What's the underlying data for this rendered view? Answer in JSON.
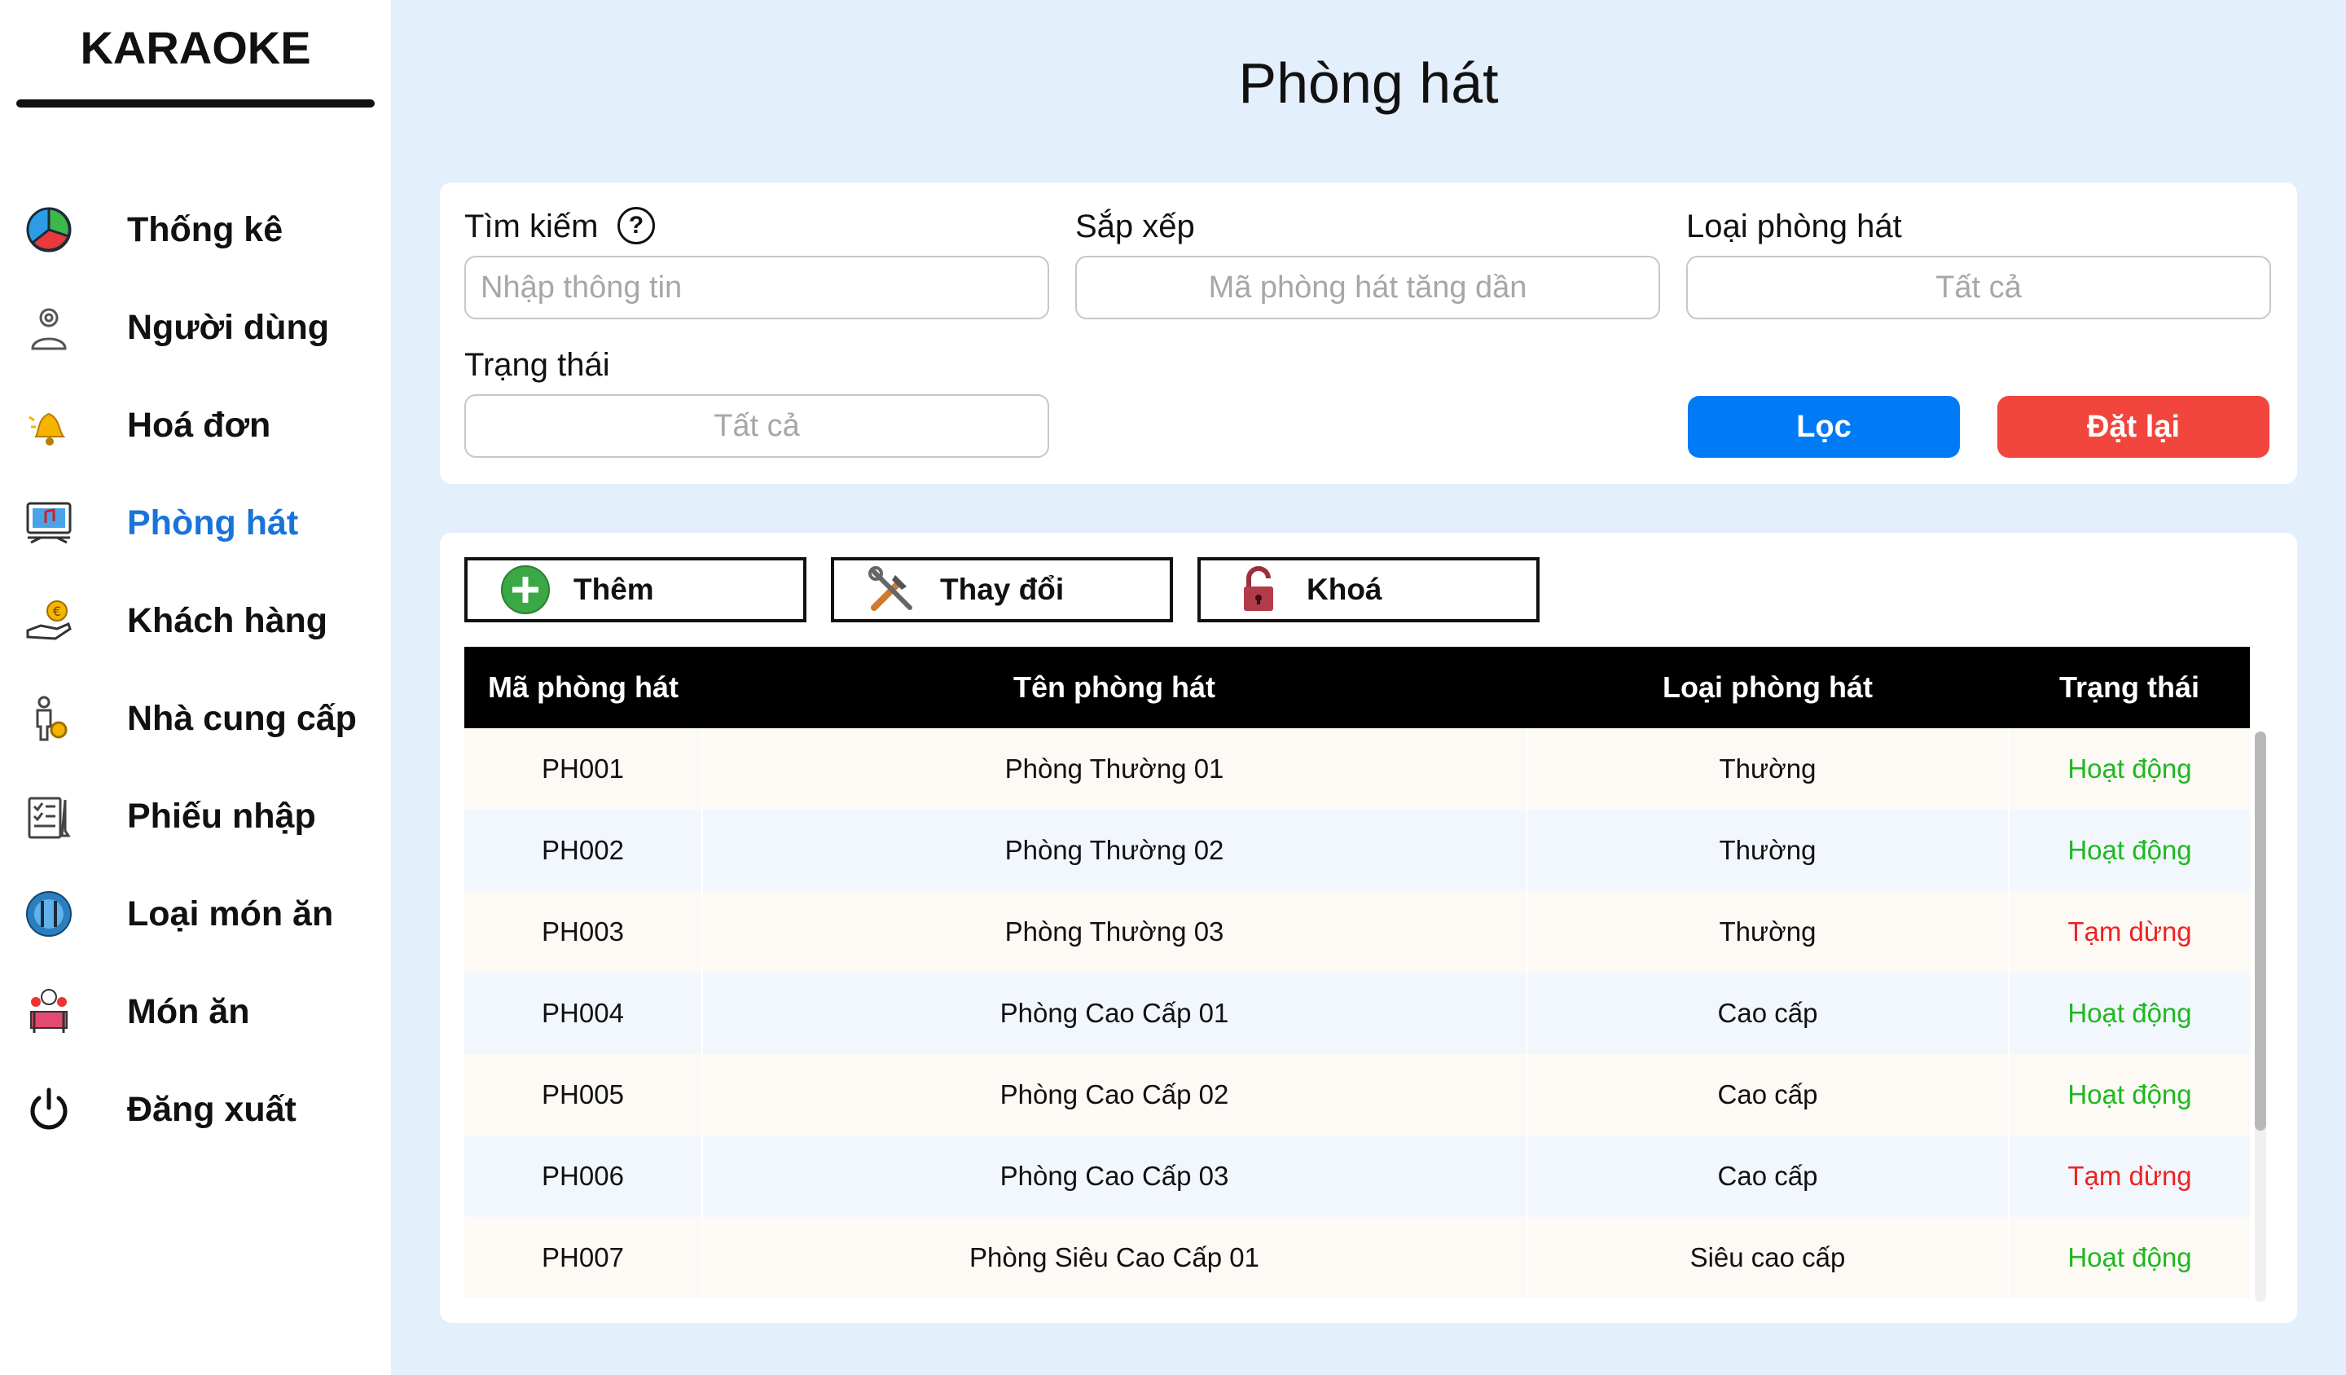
{
  "sidebar": {
    "brand": "KARAOKE",
    "items": [
      {
        "label": "Thống kê",
        "icon": "pie-chart-icon"
      },
      {
        "label": "Người dùng",
        "icon": "user-gear-icon"
      },
      {
        "label": "Hoá đơn",
        "icon": "bell-icon"
      },
      {
        "label": "Phòng hát",
        "icon": "karaoke-screen-icon",
        "active": true
      },
      {
        "label": "Khách hàng",
        "icon": "hand-coin-icon"
      },
      {
        "label": "Nhà cung cấp",
        "icon": "supplier-icon"
      },
      {
        "label": "Phiếu nhập",
        "icon": "checklist-icon"
      },
      {
        "label": "Loại món ăn",
        "icon": "dish-category-icon"
      },
      {
        "label": "Món ăn",
        "icon": "chef-table-icon"
      },
      {
        "label": "Đăng xuất",
        "icon": "power-icon"
      }
    ]
  },
  "page": {
    "title": "Phòng hát"
  },
  "filters": {
    "search_label": "Tìm kiếm",
    "search_help": "?",
    "search_placeholder": "Nhập thông tin",
    "sort_label": "Sắp xếp",
    "sort_value": "Mã phòng hát tăng dần",
    "type_label": "Loại phòng hát",
    "type_value": "Tất cả",
    "status_label": "Trạng thái",
    "status_value": "Tất cả",
    "filter_button": "Lọc",
    "reset_button": "Đặt lại"
  },
  "toolbar": {
    "add_label": "Thêm",
    "edit_label": "Thay đổi",
    "lock_label": "Khoá"
  },
  "table": {
    "headers": [
      "Mã phòng hát",
      "Tên phòng hát",
      "Loại phòng hát",
      "Trạng thái"
    ],
    "rows": [
      {
        "id": "PH001",
        "name": "Phòng Thường 01",
        "type": "Thường",
        "status": "Hoạt động",
        "active": true
      },
      {
        "id": "PH002",
        "name": "Phòng Thường 02",
        "type": "Thường",
        "status": "Hoạt động",
        "active": true
      },
      {
        "id": "PH003",
        "name": "Phòng Thường 03",
        "type": "Thường",
        "status": "Tạm dừng",
        "active": false
      },
      {
        "id": "PH004",
        "name": "Phòng Cao Cấp 01",
        "type": "Cao cấp",
        "status": "Hoạt động",
        "active": true
      },
      {
        "id": "PH005",
        "name": "Phòng Cao Cấp 02",
        "type": "Cao cấp",
        "status": "Hoạt động",
        "active": true
      },
      {
        "id": "PH006",
        "name": "Phòng Cao Cấp 03",
        "type": "Cao cấp",
        "status": "Tạm dừng",
        "active": false
      },
      {
        "id": "PH007",
        "name": "Phòng Siêu Cao Cấp 01",
        "type": "Siêu cao cấp",
        "status": "Hoạt động",
        "active": true
      }
    ]
  },
  "colors": {
    "active_nav": "#1a73d9",
    "status_active": "#1fb81f",
    "status_paused": "#ee2222",
    "filter_button": "#007bf5",
    "reset_button": "#f1453d"
  }
}
